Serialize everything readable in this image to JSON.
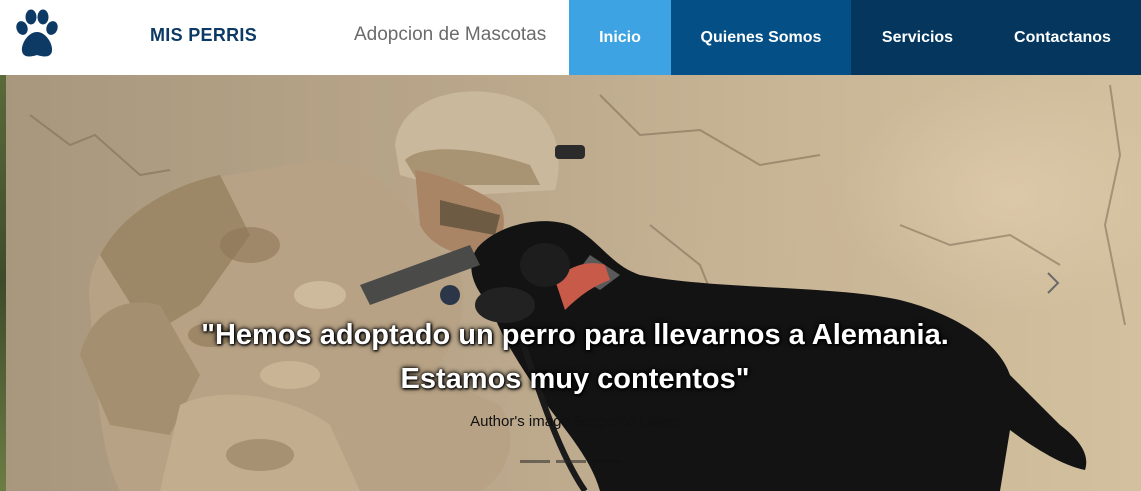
{
  "header": {
    "brand": "MIS PERRIS",
    "tagline": "Adopcion de Mascotas",
    "logo_icon": "paw-icon",
    "brand_color": "#0d3a64"
  },
  "nav": {
    "items": [
      {
        "label": "Inicio",
        "color": "#3ea3e3",
        "active": true
      },
      {
        "label": "Quienes Somos",
        "color": "#044f85"
      },
      {
        "label": "Servicios",
        "color": "#05375e"
      },
      {
        "label": "Contactanos",
        "color": "#05375e"
      }
    ]
  },
  "carousel": {
    "caption": "\"Hemos adoptado un perro para llevarnos a Alemania. Estamos muy contentos\"",
    "author": "Author's image Sergento Lawer",
    "next_icon": "chevron-right-icon",
    "indicator_count": 3,
    "active_indicator": 3
  }
}
